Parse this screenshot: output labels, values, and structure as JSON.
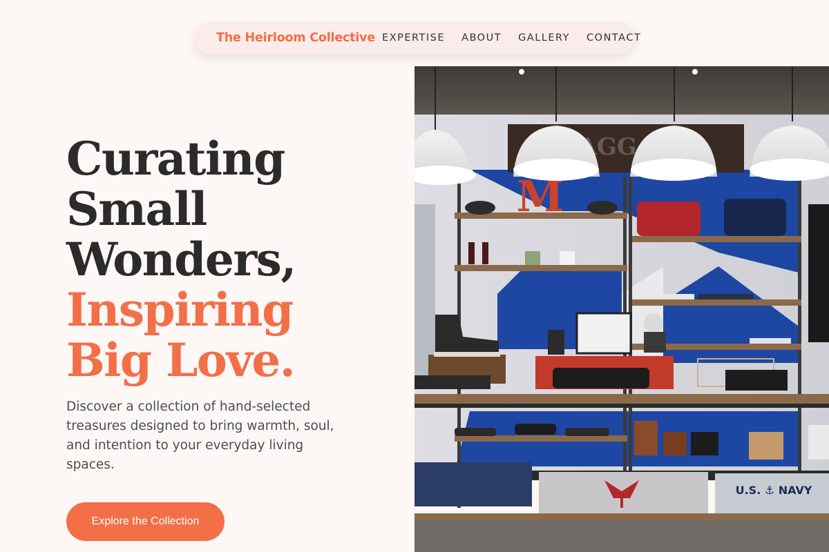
{
  "nav": {
    "brand": "The Heirloom Collective",
    "links": [
      "EXPERTISE",
      "ABOUT",
      "GALLERY",
      "CONTACT"
    ]
  },
  "hero": {
    "headline_dark": [
      "Curating",
      "Small",
      "Wonders,"
    ],
    "headline_accent": [
      "Inspiring",
      "Big Love."
    ],
    "description": "Discover a collection of hand-selected treasures designed to bring warmth, soul, and intention to your everyday living spaces.",
    "cta": "Explore the Collection"
  },
  "image": {
    "sign_text": "BAGGAGE",
    "letter": "M",
    "tee_text": "U.S. ⚓ NAVY"
  },
  "colors": {
    "accent": "#f26f47",
    "text_dark": "#2b2b2b",
    "background": "#fdf7f6",
    "nav_bg": "#f9ecea"
  }
}
